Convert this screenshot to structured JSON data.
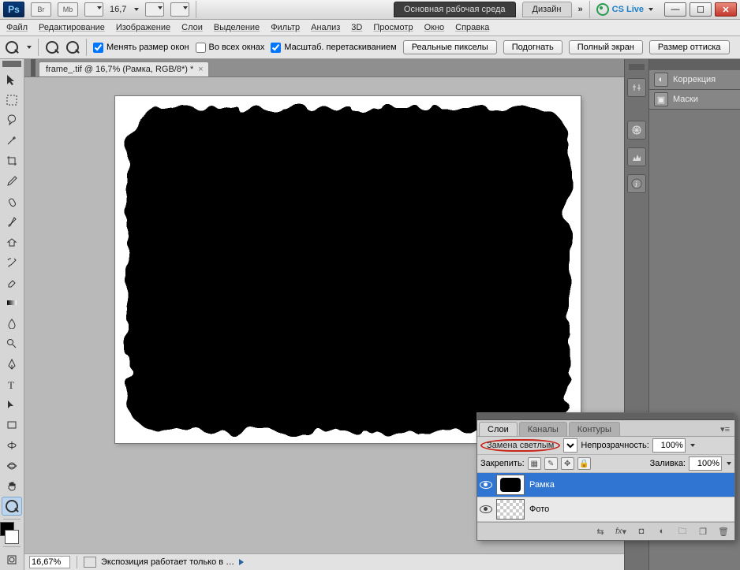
{
  "appbar": {
    "badges": [
      "Br",
      "Mb"
    ],
    "zoom": "16,7",
    "workspace_active": "Основная рабочая среда",
    "workspace_inactive": "Дизайн",
    "more": "»",
    "cs_live": "CS Live"
  },
  "menubar": [
    "Файл",
    "Редактирование",
    "Изображение",
    "Слои",
    "Выделение",
    "Фильтр",
    "Анализ",
    "3D",
    "Просмотр",
    "Окно",
    "Справка"
  ],
  "optionsbar": {
    "chk_resize": "Менять размер окон",
    "chk_allwin": "Во всех окнах",
    "chk_scrub": "Масштаб. перетаскиванием",
    "btns": [
      "Реальные пикселы",
      "Подогнать",
      "Полный экран",
      "Размер оттиска"
    ]
  },
  "doc_tab": "frame_.tif @ 16,7% (Рамка, RGB/8*) *",
  "statusbar": {
    "zoom": "16,67%",
    "info": "Экспозиция работает только в …"
  },
  "rightpanel": {
    "items": [
      {
        "icon": "◐",
        "label": "Коррекция"
      },
      {
        "icon": "▢",
        "label": "Маски"
      }
    ]
  },
  "layers_panel": {
    "tabs": [
      "Слои",
      "Каналы",
      "Контуры"
    ],
    "blend_mode": "Замена светлым",
    "opacity_label": "Непрозрачность:",
    "opacity_value": "100%",
    "lock_label": "Закрепить:",
    "fill_label": "Заливка:",
    "fill_value": "100%",
    "layers": [
      {
        "name": "Рамка",
        "selected": true,
        "thumb": "black"
      },
      {
        "name": "Фото",
        "selected": false,
        "thumb": "trans"
      }
    ]
  },
  "tool_names": [
    "move",
    "marquee",
    "lasso",
    "magic-wand",
    "crop",
    "eyedropper",
    "healing",
    "brush",
    "clone",
    "history-brush",
    "eraser",
    "gradient",
    "blur",
    "dodge",
    "pen",
    "type",
    "path-select",
    "shape",
    "3d-rotate",
    "3d-orbit",
    "hand",
    "zoom"
  ]
}
